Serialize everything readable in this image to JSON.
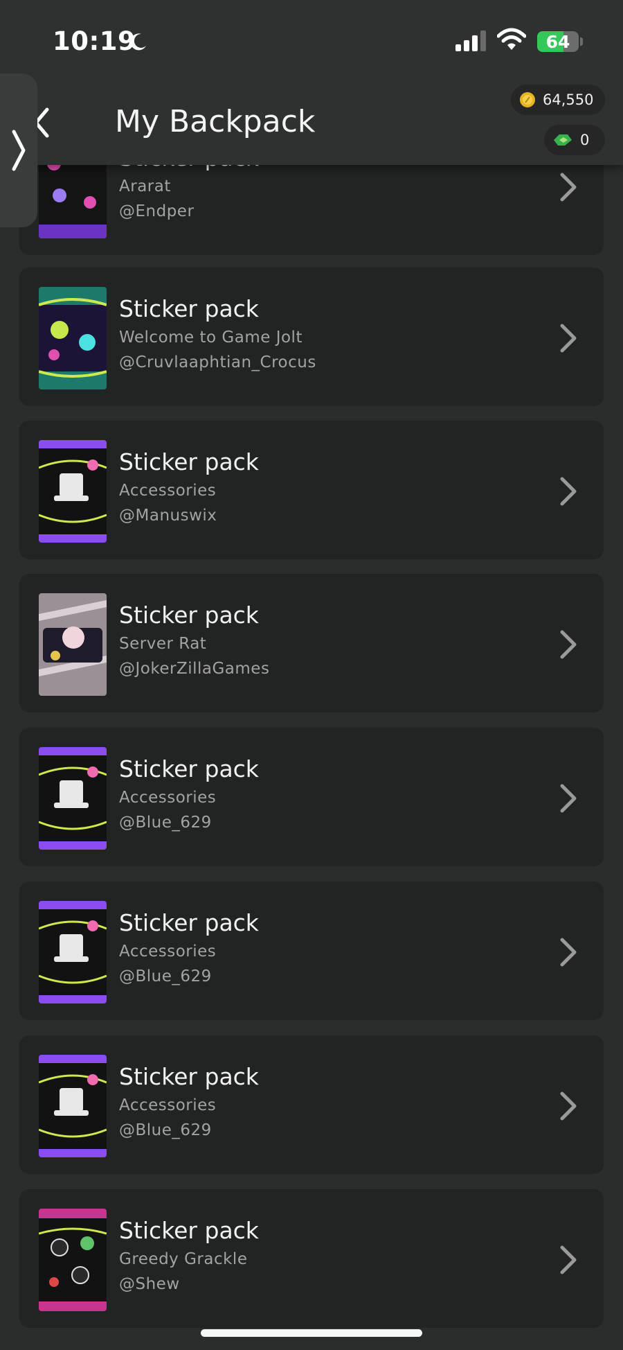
{
  "status_bar": {
    "time": "10:19",
    "battery": "64",
    "battery_level": 0.64,
    "icons": [
      "moon-icon",
      "signal-icon",
      "wifi-icon",
      "battery-icon"
    ]
  },
  "header": {
    "title": "My Backpack",
    "coins": "64,550",
    "gems": "0",
    "icons": [
      "back-chevron-icon",
      "coin-icon",
      "gem-icon"
    ]
  },
  "packs": [
    {
      "title": "Sticker pack",
      "name": "Ararat",
      "author": "@Endper",
      "color": "#7b3fd6"
    },
    {
      "title": "Sticker pack",
      "name": "Welcome to Game Jolt",
      "author": "@Cruvlaaphtian_Crocus",
      "color": "#1d7a6a"
    },
    {
      "title": "Sticker pack",
      "name": "Accessories",
      "author": "@Manuswix",
      "color": "#8a4df0"
    },
    {
      "title": "Sticker pack",
      "name": "Server Rat",
      "author": "@JokerZillaGames",
      "color": "#8b7f86"
    },
    {
      "title": "Sticker pack",
      "name": "Accessories",
      "author": "@Blue_629",
      "color": "#8a4df0"
    },
    {
      "title": "Sticker pack",
      "name": "Accessories",
      "author": "@Blue_629",
      "color": "#8a4df0"
    },
    {
      "title": "Sticker pack",
      "name": "Accessories",
      "author": "@Blue_629",
      "color": "#8a4df0"
    },
    {
      "title": "Sticker pack",
      "name": "Greedy Grackle",
      "author": "@Shew",
      "color": "#c8358f"
    }
  ]
}
